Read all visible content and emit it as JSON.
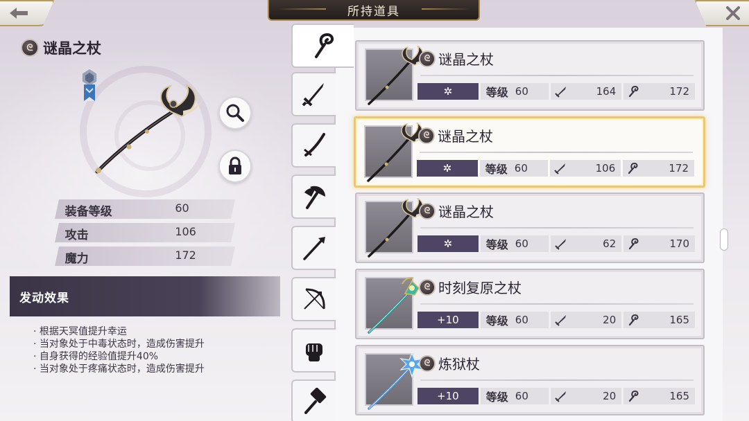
{
  "header": {
    "title": "所持道具",
    "back_icon": "back-arrow-icon",
    "close_icon": "close-icon"
  },
  "selected_item": {
    "name": "谜晶之杖",
    "stats": [
      {
        "label": "装备等级",
        "value": "60"
      },
      {
        "label": "攻击",
        "value": "106"
      },
      {
        "label": "魔力",
        "value": "172"
      }
    ],
    "effect_title": "发动效果",
    "effects": [
      "根据天冥值提升幸运",
      "当对象处于中毒状态时，造成伤害提升",
      "自身获得的经验值提升40%",
      "当对象处于疼痛状态时，造成伤害提升"
    ]
  },
  "tabs": [
    "staff-icon",
    "sword-icon",
    "katana-icon",
    "axe-icon",
    "spear-icon",
    "bow-icon",
    "fist-icon",
    "hammer-icon"
  ],
  "items": [
    {
      "name": "谜晶之杖",
      "grade": "✲",
      "level_label": "等级",
      "level": "60",
      "attack": "164",
      "magic": "172",
      "selected": false,
      "staff": "dark"
    },
    {
      "name": "谜晶之杖",
      "grade": "✲",
      "level_label": "等级",
      "level": "60",
      "attack": "106",
      "magic": "172",
      "selected": true,
      "staff": "dark"
    },
    {
      "name": "谜晶之杖",
      "grade": "✲",
      "level_label": "等级",
      "level": "60",
      "attack": "62",
      "magic": "170",
      "selected": false,
      "staff": "dark"
    },
    {
      "name": "时刻复原之杖",
      "grade": "+10",
      "level_label": "等级",
      "level": "60",
      "attack": "20",
      "magic": "165",
      "selected": false,
      "staff": "teal"
    },
    {
      "name": "炼狱杖",
      "grade": "+10",
      "level_label": "等级",
      "level": "60",
      "attack": "20",
      "magic": "165",
      "selected": false,
      "staff": "blue"
    }
  ],
  "colors": {
    "accent_gold": "#e8c878",
    "grade_purple": "#4e4463",
    "effect_header": "#3b3446"
  }
}
